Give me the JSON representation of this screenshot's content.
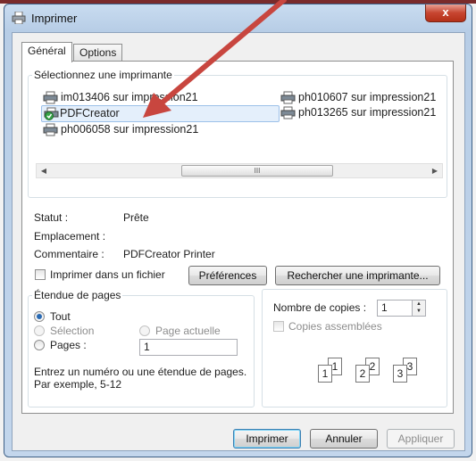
{
  "window": {
    "title": "Imprimer",
    "close_glyph": "x"
  },
  "tabs": [
    {
      "label": "Général"
    },
    {
      "label": "Options"
    }
  ],
  "printer_group": {
    "legend": "Sélectionnez une imprimante",
    "printers": [
      {
        "label": "im013406 sur impression21",
        "icon": "printer-icon"
      },
      {
        "label": "ph010607 sur impression21",
        "icon": "printer-icon"
      },
      {
        "label": "PDFCreator",
        "icon": "default-printer-icon"
      },
      {
        "label": "ph013265 sur impression21",
        "icon": "printer-icon"
      },
      {
        "label": "ph006058 sur impression21",
        "icon": "printer-icon"
      }
    ],
    "scroll_thumb_grip": "III"
  },
  "status": {
    "status_label": "Statut :",
    "status_value": "Prête",
    "location_label": "Emplacement :",
    "location_value": "",
    "comment_label": "Commentaire :",
    "comment_value": "PDFCreator Printer"
  },
  "print_to_file_label": "Imprimer dans un fichier",
  "preferences_button": "Préférences",
  "find_printer_button": "Rechercher une imprimante...",
  "page_range": {
    "legend": "Étendue de pages",
    "all_label": "Tout",
    "selection_label": "Sélection",
    "current_page_label": "Page actuelle",
    "pages_label": "Pages :",
    "pages_value": "1",
    "hint_line1": "Entrez un numéro ou une étendue de pages.",
    "hint_line2": "Par exemple, 5-12"
  },
  "copies": {
    "label": "Nombre de copies :",
    "value": "1",
    "collate_label": "Copies assemblées",
    "collate_pages": [
      {
        "back": "1",
        "front": "1"
      },
      {
        "back": "2",
        "front": "2"
      },
      {
        "back": "3",
        "front": "3"
      }
    ]
  },
  "footer": {
    "print_button": "Imprimer",
    "cancel_button": "Annuler",
    "apply_button": "Appliquer"
  },
  "colors": {
    "title_bar": "#c3d6ec",
    "close_button": "#c74530",
    "annotation_arrow": "#c8463f",
    "selection_highlight": "#e4effb"
  }
}
